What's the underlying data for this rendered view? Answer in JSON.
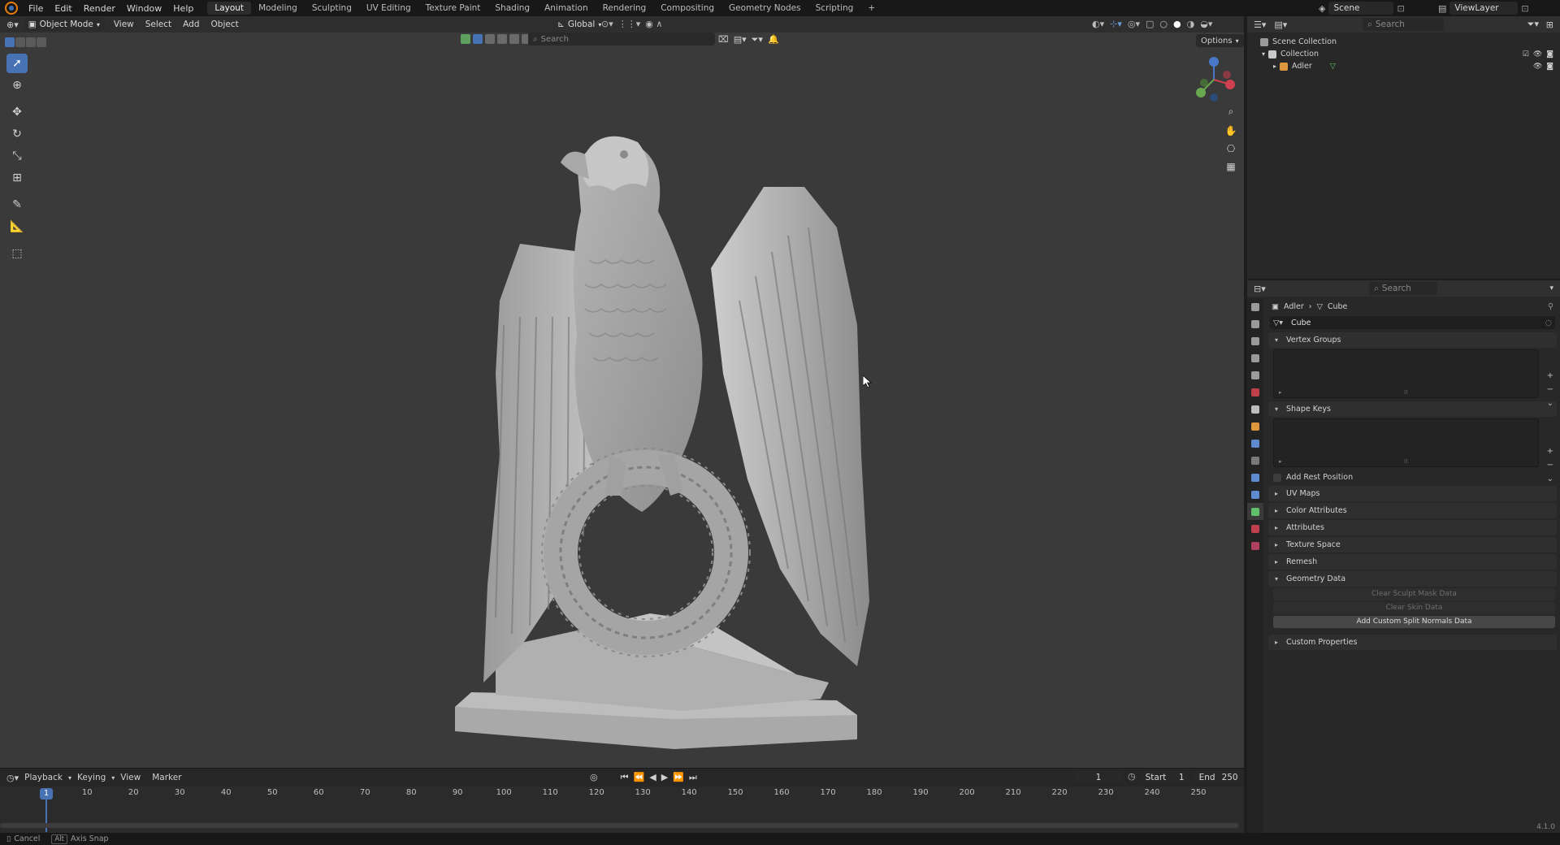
{
  "topbar": {
    "menus": [
      "File",
      "Edit",
      "Render",
      "Window",
      "Help"
    ],
    "workspaces": [
      "Layout",
      "Modeling",
      "Sculpting",
      "UV Editing",
      "Texture Paint",
      "Shading",
      "Animation",
      "Rendering",
      "Compositing",
      "Geometry Nodes",
      "Scripting"
    ],
    "active_workspace": "Layout",
    "add_tab": "+",
    "scene": "Scene",
    "view_layer": "ViewLayer"
  },
  "viewport": {
    "mode": "Object Mode",
    "menus": [
      "View",
      "Select",
      "Add",
      "Object"
    ],
    "orientation": "Global",
    "search_placeholder": "Search",
    "options_label": "Options",
    "gizmo": {
      "x": "X",
      "y": "Y",
      "z": "Z"
    }
  },
  "outliner": {
    "search_placeholder": "Search",
    "scene_collection": "Scene Collection",
    "collection": "Collection",
    "object": "Adler"
  },
  "properties": {
    "search_placeholder": "Search",
    "breadcrumb_object": "Adler",
    "breadcrumb_data": "Cube",
    "mesh_name": "Cube",
    "sections": {
      "vertex_groups": "Vertex Groups",
      "shape_keys": "Shape Keys",
      "add_rest_position": "Add Rest Position",
      "uv_maps": "UV Maps",
      "color_attributes": "Color Attributes",
      "attributes": "Attributes",
      "texture_space": "Texture Space",
      "remesh": "Remesh",
      "geometry_data": "Geometry Data",
      "custom_properties": "Custom Properties"
    },
    "geometry_buttons": {
      "clear_sculpt": "Clear Sculpt Mask Data",
      "clear_skin": "Clear Skin Data",
      "add_split_normals": "Add Custom Split Normals Data"
    },
    "version": "4.1.0"
  },
  "timeline": {
    "menus": [
      "Playback",
      "Keying",
      "View",
      "Marker"
    ],
    "current_frame": "1",
    "start_label": "Start",
    "start_value": "1",
    "end_label": "End",
    "end_value": "250",
    "ticks": [
      "1",
      "10",
      "20",
      "30",
      "40",
      "50",
      "60",
      "70",
      "80",
      "90",
      "100",
      "110",
      "120",
      "130",
      "140",
      "150",
      "160",
      "170",
      "180",
      "190",
      "200",
      "210",
      "220",
      "230",
      "240",
      "250"
    ]
  },
  "statusbar": {
    "cancel": "Cancel",
    "alt_key": "Alt",
    "axis_snap": "Axis Snap"
  }
}
